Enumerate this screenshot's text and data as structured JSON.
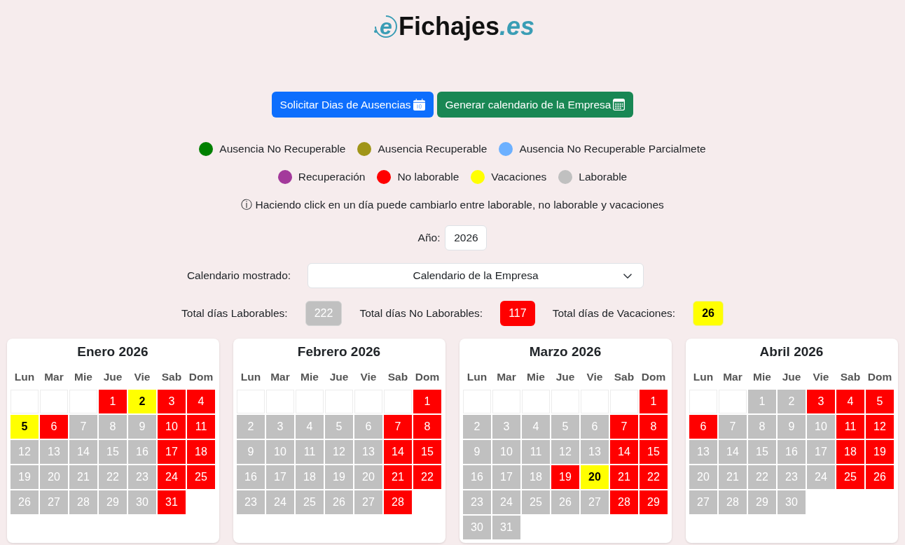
{
  "logo": {
    "mark": "e",
    "name": "Fichajes",
    "domain": ".es"
  },
  "buttons": [
    {
      "label": "Solicitar Dias de Ausencias",
      "kind": "request"
    },
    {
      "label": "Generar calendario de la Empresa",
      "kind": "generate"
    }
  ],
  "legend": [
    [
      {
        "label": "Ausencia No Recuperable",
        "color": "#008000"
      },
      {
        "label": "Ausencia Recuperable",
        "color": "#a09518"
      },
      {
        "label": "Ausencia No Recuperable Parcialmete",
        "color": "#6cb0ff"
      }
    ],
    [
      {
        "label": "Recuperación",
        "color": "#a3399b"
      },
      {
        "label": "No laborable",
        "color": "#ff0000"
      },
      {
        "label": "Vacaciones",
        "color": "#ffff00"
      },
      {
        "label": "Laborable",
        "color": "#c0c0c0"
      }
    ]
  ],
  "hint": "ⓘ Haciendo click en un día puede cambiarlo entre laborable, no laborable y vacaciones",
  "year": {
    "label": "Año:",
    "value": "2026"
  },
  "calendar_select": {
    "label": "Calendario mostrado:",
    "value": "Calendario de la Empresa"
  },
  "totals": [
    {
      "label": "Total días Laborables:",
      "value": "222",
      "kind": "work"
    },
    {
      "label": "Total días No Laborables:",
      "value": "117",
      "kind": "off"
    },
    {
      "label": "Total días de Vacaciones:",
      "value": "26",
      "kind": "vacation"
    }
  ],
  "months": [
    {
      "title": "Enero 2026",
      "weekdays": [
        "Lun",
        "Mar",
        "Mie",
        "Jue",
        "Vie",
        "Sab",
        "Dom"
      ],
      "weeks": [
        [
          {
            "kind": "blank"
          },
          {
            "kind": "blank"
          },
          {
            "kind": "blank"
          },
          {
            "day": "1",
            "kind": "off"
          },
          {
            "day": "2",
            "kind": "vacation"
          },
          {
            "day": "3",
            "kind": "off"
          },
          {
            "day": "4",
            "kind": "off"
          }
        ],
        [
          {
            "day": "5",
            "kind": "vacation"
          },
          {
            "day": "6",
            "kind": "off"
          },
          {
            "day": "7",
            "kind": "work"
          },
          {
            "day": "8",
            "kind": "work"
          },
          {
            "day": "9",
            "kind": "work"
          },
          {
            "day": "10",
            "kind": "off"
          },
          {
            "day": "11",
            "kind": "off"
          }
        ],
        [
          {
            "day": "12",
            "kind": "work"
          },
          {
            "day": "13",
            "kind": "work"
          },
          {
            "day": "14",
            "kind": "work"
          },
          {
            "day": "15",
            "kind": "work"
          },
          {
            "day": "16",
            "kind": "work"
          },
          {
            "day": "17",
            "kind": "off"
          },
          {
            "day": "18",
            "kind": "off"
          }
        ],
        [
          {
            "day": "19",
            "kind": "work"
          },
          {
            "day": "20",
            "kind": "work"
          },
          {
            "day": "21",
            "kind": "work"
          },
          {
            "day": "22",
            "kind": "work"
          },
          {
            "day": "23",
            "kind": "work"
          },
          {
            "day": "24",
            "kind": "off"
          },
          {
            "day": "25",
            "kind": "off"
          }
        ],
        [
          {
            "day": "26",
            "kind": "work"
          },
          {
            "day": "27",
            "kind": "work"
          },
          {
            "day": "28",
            "kind": "work"
          },
          {
            "day": "29",
            "kind": "work"
          },
          {
            "day": "30",
            "kind": "work"
          },
          {
            "day": "31",
            "kind": "off"
          }
        ]
      ]
    },
    {
      "title": "Febrero 2026",
      "weekdays": [
        "Lun",
        "Mar",
        "Mie",
        "Jue",
        "Vie",
        "Sab",
        "Dom"
      ],
      "weeks": [
        [
          {
            "kind": "blank"
          },
          {
            "kind": "blank"
          },
          {
            "kind": "blank"
          },
          {
            "kind": "blank"
          },
          {
            "kind": "blank"
          },
          {
            "kind": "blank"
          },
          {
            "day": "1",
            "kind": "off"
          }
        ],
        [
          {
            "day": "2",
            "kind": "work"
          },
          {
            "day": "3",
            "kind": "work"
          },
          {
            "day": "4",
            "kind": "work"
          },
          {
            "day": "5",
            "kind": "work"
          },
          {
            "day": "6",
            "kind": "work"
          },
          {
            "day": "7",
            "kind": "off"
          },
          {
            "day": "8",
            "kind": "off"
          }
        ],
        [
          {
            "day": "9",
            "kind": "work"
          },
          {
            "day": "10",
            "kind": "work"
          },
          {
            "day": "11",
            "kind": "work"
          },
          {
            "day": "12",
            "kind": "work"
          },
          {
            "day": "13",
            "kind": "work"
          },
          {
            "day": "14",
            "kind": "off"
          },
          {
            "day": "15",
            "kind": "off"
          }
        ],
        [
          {
            "day": "16",
            "kind": "work"
          },
          {
            "day": "17",
            "kind": "work"
          },
          {
            "day": "18",
            "kind": "work"
          },
          {
            "day": "19",
            "kind": "work"
          },
          {
            "day": "20",
            "kind": "work"
          },
          {
            "day": "21",
            "kind": "off"
          },
          {
            "day": "22",
            "kind": "off"
          }
        ],
        [
          {
            "day": "23",
            "kind": "work"
          },
          {
            "day": "24",
            "kind": "work"
          },
          {
            "day": "25",
            "kind": "work"
          },
          {
            "day": "26",
            "kind": "work"
          },
          {
            "day": "27",
            "kind": "work"
          },
          {
            "day": "28",
            "kind": "off"
          }
        ]
      ]
    },
    {
      "title": "Marzo 2026",
      "weekdays": [
        "Lun",
        "Mar",
        "Mie",
        "Jue",
        "Vie",
        "Sab",
        "Dom"
      ],
      "weeks": [
        [
          {
            "kind": "blank"
          },
          {
            "kind": "blank"
          },
          {
            "kind": "blank"
          },
          {
            "kind": "blank"
          },
          {
            "kind": "blank"
          },
          {
            "kind": "blank"
          },
          {
            "day": "1",
            "kind": "off"
          }
        ],
        [
          {
            "day": "2",
            "kind": "work"
          },
          {
            "day": "3",
            "kind": "work"
          },
          {
            "day": "4",
            "kind": "work"
          },
          {
            "day": "5",
            "kind": "work"
          },
          {
            "day": "6",
            "kind": "work"
          },
          {
            "day": "7",
            "kind": "off"
          },
          {
            "day": "8",
            "kind": "off"
          }
        ],
        [
          {
            "day": "9",
            "kind": "work"
          },
          {
            "day": "10",
            "kind": "work"
          },
          {
            "day": "11",
            "kind": "work"
          },
          {
            "day": "12",
            "kind": "work"
          },
          {
            "day": "13",
            "kind": "work"
          },
          {
            "day": "14",
            "kind": "off"
          },
          {
            "day": "15",
            "kind": "off"
          }
        ],
        [
          {
            "day": "16",
            "kind": "work"
          },
          {
            "day": "17",
            "kind": "work"
          },
          {
            "day": "18",
            "kind": "work"
          },
          {
            "day": "19",
            "kind": "off"
          },
          {
            "day": "20",
            "kind": "vacation"
          },
          {
            "day": "21",
            "kind": "off"
          },
          {
            "day": "22",
            "kind": "off"
          }
        ],
        [
          {
            "day": "23",
            "kind": "work"
          },
          {
            "day": "24",
            "kind": "work"
          },
          {
            "day": "25",
            "kind": "work"
          },
          {
            "day": "26",
            "kind": "work"
          },
          {
            "day": "27",
            "kind": "work"
          },
          {
            "day": "28",
            "kind": "off"
          },
          {
            "day": "29",
            "kind": "off"
          }
        ],
        [
          {
            "day": "30",
            "kind": "work"
          },
          {
            "day": "31",
            "kind": "work"
          }
        ]
      ]
    },
    {
      "title": "Abril 2026",
      "weekdays": [
        "Lun",
        "Mar",
        "Mie",
        "Jue",
        "Vie",
        "Sab",
        "Dom"
      ],
      "weeks": [
        [
          {
            "kind": "blank"
          },
          {
            "kind": "blank"
          },
          {
            "day": "1",
            "kind": "work"
          },
          {
            "day": "2",
            "kind": "work"
          },
          {
            "day": "3",
            "kind": "off"
          },
          {
            "day": "4",
            "kind": "off"
          },
          {
            "day": "5",
            "kind": "off"
          }
        ],
        [
          {
            "day": "6",
            "kind": "off"
          },
          {
            "day": "7",
            "kind": "work"
          },
          {
            "day": "8",
            "kind": "work"
          },
          {
            "day": "9",
            "kind": "work"
          },
          {
            "day": "10",
            "kind": "work"
          },
          {
            "day": "11",
            "kind": "off"
          },
          {
            "day": "12",
            "kind": "off"
          }
        ],
        [
          {
            "day": "13",
            "kind": "work"
          },
          {
            "day": "14",
            "kind": "work"
          },
          {
            "day": "15",
            "kind": "work"
          },
          {
            "day": "16",
            "kind": "work"
          },
          {
            "day": "17",
            "kind": "work"
          },
          {
            "day": "18",
            "kind": "off"
          },
          {
            "day": "19",
            "kind": "off"
          }
        ],
        [
          {
            "day": "20",
            "kind": "work"
          },
          {
            "day": "21",
            "kind": "work"
          },
          {
            "day": "22",
            "kind": "work"
          },
          {
            "day": "23",
            "kind": "work"
          },
          {
            "day": "24",
            "kind": "work"
          },
          {
            "day": "25",
            "kind": "off"
          },
          {
            "day": "26",
            "kind": "off"
          }
        ],
        [
          {
            "day": "27",
            "kind": "work"
          },
          {
            "day": "28",
            "kind": "work"
          },
          {
            "day": "29",
            "kind": "work"
          },
          {
            "day": "30",
            "kind": "work"
          }
        ]
      ]
    }
  ]
}
